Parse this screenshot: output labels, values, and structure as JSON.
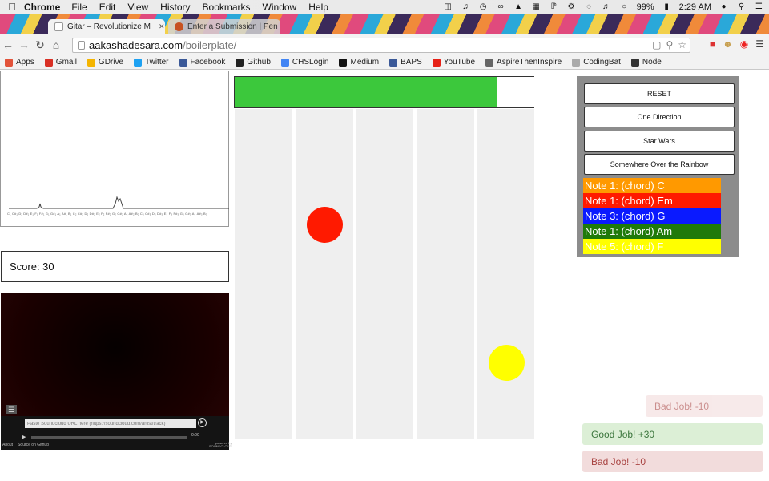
{
  "menubar": {
    "app": "Chrome",
    "menus": [
      "File",
      "Edit",
      "View",
      "History",
      "Bookmarks",
      "Window",
      "Help"
    ],
    "battery": "99%",
    "time": "2:29 AM"
  },
  "browser": {
    "tabs": [
      {
        "title": "Gitar – Revolutionize M",
        "active": true
      },
      {
        "title": "Enter a Submission | Pen",
        "active": false
      }
    ],
    "url_host": "aakashadesara.com",
    "url_path": "/boilerplate/"
  },
  "bookmarks": [
    {
      "label": "Apps",
      "icon": "apps-grid-icon",
      "color": "#e2533a"
    },
    {
      "label": "Gmail",
      "icon": "gmail-icon",
      "color": "#d93025"
    },
    {
      "label": "GDrive",
      "icon": "drive-icon",
      "color": "#f4b400"
    },
    {
      "label": "Twitter",
      "icon": "twitter-icon",
      "color": "#1da1f2"
    },
    {
      "label": "Facebook",
      "icon": "facebook-icon",
      "color": "#3b5998"
    },
    {
      "label": "Github",
      "icon": "github-icon",
      "color": "#222222"
    },
    {
      "label": "CHSLogin",
      "icon": "google-icon",
      "color": "#4285f4"
    },
    {
      "label": "Medium",
      "icon": "medium-icon",
      "color": "#111111"
    },
    {
      "label": "BAPS",
      "icon": "facebook-icon",
      "color": "#3b5998"
    },
    {
      "label": "YouTube",
      "icon": "youtube-icon",
      "color": "#e62117"
    },
    {
      "label": "AspireThenInspire",
      "icon": "blog-icon",
      "color": "#666666"
    },
    {
      "label": "CodingBat",
      "icon": "page-icon",
      "color": "#aaaaaa"
    },
    {
      "label": "Node",
      "icon": "node-icon",
      "color": "#333333"
    }
  ],
  "visualizer": {
    "freq_labels": "C₁ C#₁ D₁ D#₁ E₁ F₁ F#₁ G₁ G#₁ A₁ A#₁ B₁ C₂ C#₂ D₂ D#₂ E₂ F₂ F#₂ G₂ G#₂ A₂ A#₂ B₂ C₃ C#₃ D₃ D#₃ E₃ F₃ F#₃ G₃ G#₃ A₃ A#₃ B₃"
  },
  "score": {
    "text": "Score: 30"
  },
  "player": {
    "url_placeholder": "Paste Soundcloud URL here (https://soundcloud.com/artist/track)",
    "time": "0:00",
    "about": "About",
    "source": "Source on Github",
    "powered": "powered by SOUNDCLOUD"
  },
  "progress": {
    "fraction": 0.873,
    "color": "#3cc83c"
  },
  "lanes": {
    "count": 5,
    "balls": [
      {
        "lane": 1,
        "color": "#ff1a00"
      },
      {
        "lane": 4,
        "color": "#ffff00"
      }
    ]
  },
  "panel": {
    "buttons": [
      "RESET",
      "One Direction",
      "Star Wars",
      "Somewhere Over the Rainbow"
    ],
    "notes": [
      {
        "text": "Note 1: (chord) C",
        "color": "#ff9900"
      },
      {
        "text": "Note 1: (chord) Em",
        "color": "#ff1a00"
      },
      {
        "text": "Note 3: (chord) G",
        "color": "#0a1aff"
      },
      {
        "text": "Note 1: (chord) Am",
        "color": "#1f7a0a"
      },
      {
        "text": "Note 5: (chord) F",
        "color": "#ffff00"
      }
    ]
  },
  "toasts": [
    {
      "text": "Bad Job! -10",
      "kind": "bad",
      "faded": true
    },
    {
      "text": "Good Job! +30",
      "kind": "good",
      "faded": false
    },
    {
      "text": "Bad Job! -10",
      "kind": "bad",
      "faded": false
    }
  ]
}
